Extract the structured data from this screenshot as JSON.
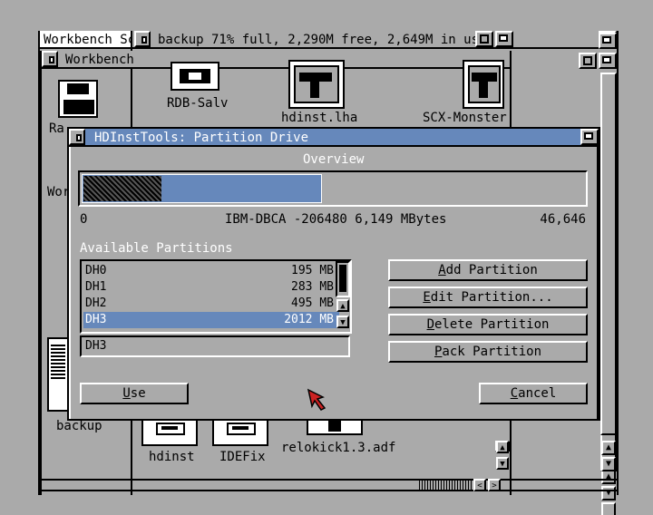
{
  "workbench_window": {
    "title": "Workbench Sc"
  },
  "backup_window": {
    "title": "backup  71% full, 2,290M free, 2,649M in us"
  },
  "workbench_subwindow": {
    "title": "Workbench"
  },
  "desktop_icons": {
    "ram_disk_label": "Ra",
    "workbench_label": "Wor",
    "backup_label": "backup",
    "rdb_salv": "RDB-Salv",
    "hdinst_lha": "hdinst.lha",
    "scx_monster": "SCX-Monster",
    "hdinst": "hdinst",
    "idefix": "IDEFix",
    "relokick": "relokick1.3.adf"
  },
  "dialog": {
    "title": "HDInstTools: Partition Drive",
    "overview_label": "Overview",
    "drive_start": "0",
    "drive_info": "IBM-DBCA -206480  6,149 MBytes",
    "drive_end": "46,646",
    "available_label": "Available Partitions",
    "partitions": [
      {
        "name": "DH0",
        "size": "195 MB"
      },
      {
        "name": "DH1",
        "size": "283 MB"
      },
      {
        "name": "DH2",
        "size": "495 MB"
      },
      {
        "name": "DH3",
        "size": "2012 MB"
      }
    ],
    "selected_partition": "DH3",
    "name_field_value": "DH3",
    "usage_fraction": 0.29,
    "buttons": {
      "add": {
        "hotkey": "A",
        "rest": "dd Partition"
      },
      "edit": {
        "hotkey": "E",
        "rest": "dit Partition..."
      },
      "delete": {
        "hotkey": "D",
        "rest": "elete Partition"
      },
      "pack": {
        "hotkey": "P",
        "rest": "ack Partition"
      },
      "use": {
        "hotkey": "U",
        "rest": "se"
      },
      "cancel": {
        "hotkey": "C",
        "rest": "ancel"
      }
    }
  },
  "colors": {
    "desktop": "#aaaaaa",
    "accent": "#6688bb",
    "pointer": "#cc2222"
  }
}
